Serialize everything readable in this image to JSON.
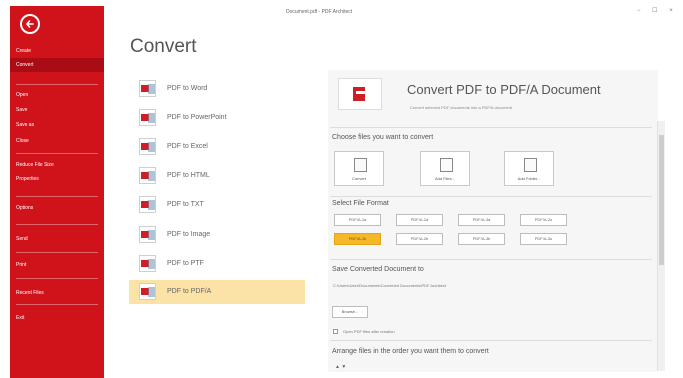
{
  "window": {
    "title": "Document.pdf - PDF Architect",
    "controls": "− ☐ ×"
  },
  "sidebar": {
    "back_icon": "back-arrow-icon",
    "items": [
      {
        "label": "Create"
      },
      {
        "label": "Convert",
        "active": true
      },
      {
        "label": "Open"
      },
      {
        "label": "Save"
      },
      {
        "label": "Save as"
      },
      {
        "label": "Close"
      },
      {
        "label": "Reduce File Size"
      },
      {
        "label": "Properties"
      },
      {
        "label": "Options"
      },
      {
        "label": "Send"
      },
      {
        "label": "Print"
      },
      {
        "label": "Recent Files"
      },
      {
        "label": "Exit"
      }
    ]
  },
  "page_title": "Convert",
  "formats": [
    {
      "label": "PDF to Word",
      "icon": "pdf-to-word-icon"
    },
    {
      "label": "PDF to PowerPoint",
      "icon": "pdf-to-powerpoint-icon"
    },
    {
      "label": "PDF to Excel",
      "icon": "pdf-to-excel-icon"
    },
    {
      "label": "PDF to HTML",
      "icon": "pdf-to-html-icon"
    },
    {
      "label": "PDF to TXT",
      "icon": "pdf-to-txt-icon"
    },
    {
      "label": "PDF to Image",
      "icon": "pdf-to-image-icon"
    },
    {
      "label": "PDF to PTF",
      "icon": "pdf-to-ptf-icon"
    },
    {
      "label": "PDF to PDF/A",
      "icon": "pdf-to-pdfa-icon",
      "active": true
    }
  ],
  "right": {
    "heading": "Convert PDF to PDF/A Document",
    "subheading": "Convert selected PDF documents into a PDF/A document",
    "choose_label": "Choose files you want to convert",
    "actions": [
      {
        "label": "Convert",
        "icon": "convert-icon"
      },
      {
        "label": "Add Files...",
        "icon": "add-files-icon"
      },
      {
        "label": "Add Folder...",
        "icon": "add-folder-icon"
      }
    ],
    "format_label": "Select File Format",
    "pdfa_row1": [
      "PDF/A-1a",
      "PDF/A-2a",
      "PDF/A-3a",
      "PDF/A-2u"
    ],
    "pdfa_row2": [
      "PDF/A-1b",
      "PDF/A-2b",
      "PDF/A-3b",
      "PDF/A-3u"
    ],
    "save_label": "Save Converted Document to",
    "output_path": "C:\\Users\\User\\Documents\\Converted Documents\\PDF Architect",
    "browse_label": "Browse...",
    "open_files_label": "Open PDF files after creation",
    "order_label": "Arrange files in the order you want them to convert",
    "order_controls": "▲ ▼"
  },
  "colors": {
    "brand_red": "#d0121b",
    "active_sidebar": "#a90c14",
    "selected_item": "#fbe2a6",
    "selected_pdfa": "#f5b828"
  }
}
